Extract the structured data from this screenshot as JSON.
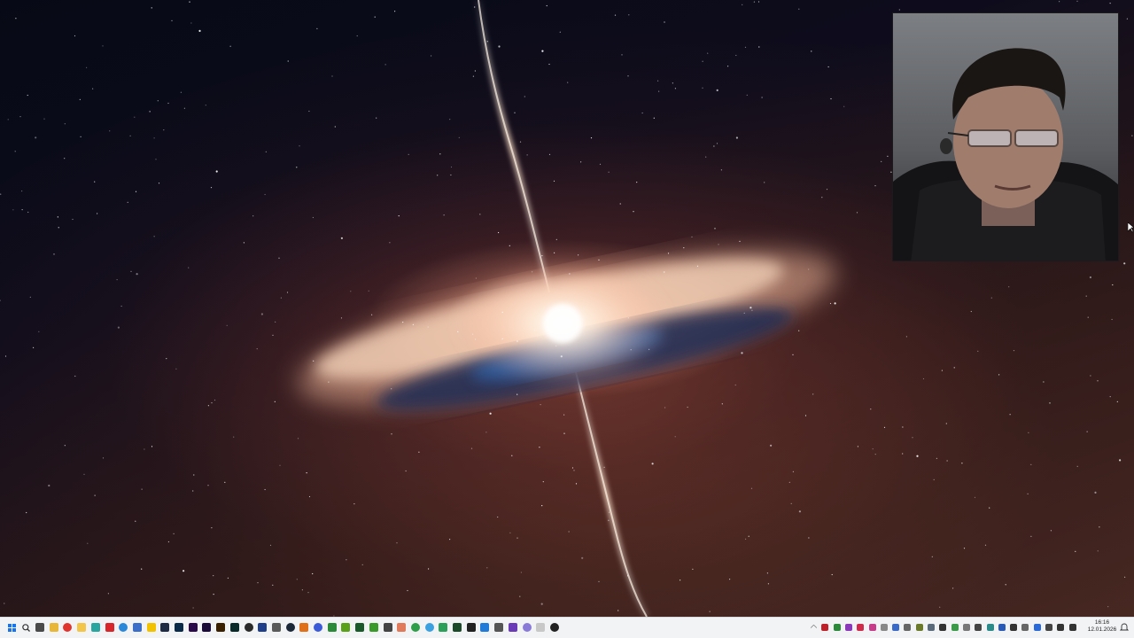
{
  "desktop": {
    "wallpaper_icon": "star-nebula-wallpaper",
    "colors": {
      "space": "#0a0812",
      "disk_glow": "#ffe6d2",
      "disk_dust": "#f2b89a",
      "disk_shadow": "#2a3a66",
      "jet": "#ffd9b8"
    }
  },
  "webcam": {
    "icon": "person-webcam-overlay"
  },
  "taskbar": {
    "start_icon": "windows-start-icon",
    "search_icon": "search-icon",
    "apps": [
      {
        "name": "task-view-icon",
        "color": "#4a4a4a",
        "shape": "square"
      },
      {
        "name": "file-explorer-icon",
        "color": "#e8b73a",
        "shape": "square"
      },
      {
        "name": "vivaldi-icon",
        "color": "#e0342f",
        "shape": "round"
      },
      {
        "name": "folder-icon",
        "color": "#f3c64a",
        "shape": "square"
      },
      {
        "name": "app-teal-icon",
        "color": "#2aa6a0",
        "shape": "square"
      },
      {
        "name": "acrobat-icon",
        "color": "#d9262a",
        "shape": "square"
      },
      {
        "name": "edge-icon",
        "color": "#2b88d8",
        "shape": "round"
      },
      {
        "name": "app-blue-icon",
        "color": "#3a6ec8",
        "shape": "square"
      },
      {
        "name": "notes-icon",
        "color": "#f2c200",
        "shape": "square"
      },
      {
        "name": "terminal-icon",
        "color": "#1f2a44",
        "shape": "square"
      },
      {
        "name": "photoshop-icon",
        "color": "#0a2a4a",
        "shape": "square"
      },
      {
        "name": "premiere-icon",
        "color": "#2a0a4a",
        "shape": "square"
      },
      {
        "name": "after-effects-icon",
        "color": "#1a0a3a",
        "shape": "square"
      },
      {
        "name": "illustrator-icon",
        "color": "#3a2000",
        "shape": "square"
      },
      {
        "name": "media-encoder-icon",
        "color": "#0a2a2a",
        "shape": "square"
      },
      {
        "name": "obs-icon",
        "color": "#2a2a2a",
        "shape": "round"
      },
      {
        "name": "app-navy-icon",
        "color": "#1f3f8a",
        "shape": "square"
      },
      {
        "name": "app-grey-icon",
        "color": "#5a5a5a",
        "shape": "square"
      },
      {
        "name": "steam-icon",
        "color": "#1b2838",
        "shape": "round"
      },
      {
        "name": "app-orange-icon",
        "color": "#e0701a",
        "shape": "square"
      },
      {
        "name": "app-blue2-icon",
        "color": "#3a5ad8",
        "shape": "round"
      },
      {
        "name": "app-green-icon",
        "color": "#2a8a3a",
        "shape": "square"
      },
      {
        "name": "nvidia-icon",
        "color": "#5aa11a",
        "shape": "square"
      },
      {
        "name": "app-darkgreen-icon",
        "color": "#1a5a2a",
        "shape": "square"
      },
      {
        "name": "app-lime-icon",
        "color": "#3a9a2a",
        "shape": "square"
      },
      {
        "name": "keyboard-icon",
        "color": "#444444",
        "shape": "square"
      },
      {
        "name": "app-salmon-icon",
        "color": "#e07a5a",
        "shape": "square"
      },
      {
        "name": "chrome-icon",
        "color": "#2f9e4a",
        "shape": "round"
      },
      {
        "name": "app-sky-icon",
        "color": "#3aa0e0",
        "shape": "round"
      },
      {
        "name": "app-green2-icon",
        "color": "#2aa05a",
        "shape": "square"
      },
      {
        "name": "app-darkgreen2-icon",
        "color": "#1a4a2a",
        "shape": "square"
      },
      {
        "name": "app-black-icon",
        "color": "#222222",
        "shape": "square"
      },
      {
        "name": "vscode-icon",
        "color": "#1f7ad8",
        "shape": "square"
      },
      {
        "name": "app-grey2-icon",
        "color": "#555555",
        "shape": "square"
      },
      {
        "name": "app-purple-icon",
        "color": "#6a3ab8",
        "shape": "square"
      },
      {
        "name": "app-lavender-icon",
        "color": "#8a7ad8",
        "shape": "round"
      },
      {
        "name": "app-light-icon",
        "color": "#c8c8c8",
        "shape": "square"
      },
      {
        "name": "chatgpt-icon",
        "color": "#222222",
        "shape": "round"
      }
    ],
    "tray": [
      {
        "name": "chevron-up-icon",
        "color": "#555555"
      },
      {
        "name": "record-icon",
        "color": "#c0202a"
      },
      {
        "name": "tray-green-icon",
        "color": "#2a8a3a"
      },
      {
        "name": "tray-purple-icon",
        "color": "#8a3ab8"
      },
      {
        "name": "tray-red-icon",
        "color": "#d02a4a"
      },
      {
        "name": "tray-pink-icon",
        "color": "#c83a8a"
      },
      {
        "name": "cloud-icon",
        "color": "#888888"
      },
      {
        "name": "tray-blue-icon",
        "color": "#3a6ac8"
      },
      {
        "name": "tray-grey-icon",
        "color": "#666666"
      },
      {
        "name": "tray-olive-icon",
        "color": "#6a7a2a"
      },
      {
        "name": "tray-slate-icon",
        "color": "#5a6a7a"
      },
      {
        "name": "tray-dark-icon",
        "color": "#333333"
      },
      {
        "name": "tray-green2-icon",
        "color": "#3a9a4a"
      },
      {
        "name": "tray-grey2-icon",
        "color": "#777777"
      },
      {
        "name": "monitor-icon",
        "color": "#444444"
      },
      {
        "name": "tray-teal-icon",
        "color": "#2a8a8a"
      },
      {
        "name": "tray-blue2-icon",
        "color": "#2a5ab8"
      },
      {
        "name": "tray-dark2-icon",
        "color": "#333333"
      },
      {
        "name": "tray-grey3-icon",
        "color": "#666666"
      },
      {
        "name": "bluetooth-icon",
        "color": "#2a6ad8"
      },
      {
        "name": "microphone-icon",
        "color": "#444444"
      },
      {
        "name": "wifi-icon",
        "color": "#333333"
      },
      {
        "name": "volume-icon",
        "color": "#333333"
      }
    ],
    "clock": {
      "time": "16:16",
      "date": "12.01.2026"
    },
    "notification_icon": "notification-bell-icon"
  }
}
